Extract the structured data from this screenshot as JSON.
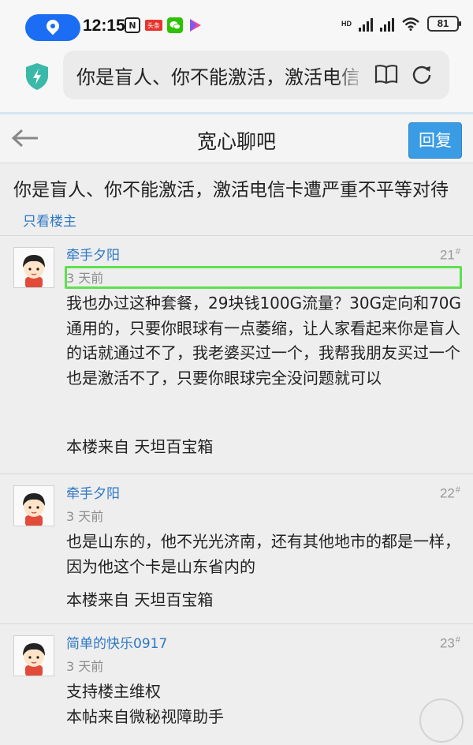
{
  "status_bar": {
    "time": "12:15",
    "battery": "81",
    "network": "HD",
    "app_badge": "头条"
  },
  "browser": {
    "url_text": "你是盲人、你不能激活，激活电信卡遭严重不平等对待"
  },
  "header": {
    "title": "宽心聊吧",
    "reply_label": "回复"
  },
  "thread": {
    "title": "你是盲人、你不能激活，激活电信卡遭严重不平等对待",
    "op_only_label": "只看楼主"
  },
  "posts": [
    {
      "author": "牵手夕阳",
      "floor": "21",
      "floor_mark": "#",
      "ago": "3 天前",
      "body": "我也办过这种套餐，29块钱100G流量？30G定向和70G通用的，只要你眼球有一点萎缩，让人家看起来你是盲人的话就通过不了，我老婆买过一个，我帮我朋友买过一个也是激活不了，只要你眼球完全没问题就可以",
      "source": "本楼来自 天坦百宝箱"
    },
    {
      "author": "牵手夕阳",
      "floor": "22",
      "floor_mark": "#",
      "ago": "3 天前",
      "body": "也是山东的，他不光光济南，还有其他地市的都是一样，因为他这个卡是山东省内的",
      "source": "本楼来自 天坦百宝箱"
    },
    {
      "author": "简单的快乐0917",
      "floor": "23",
      "floor_mark": "#",
      "ago": "3 天前",
      "body": "支持楼主维权",
      "source": "本帖来自微秘视障助手"
    }
  ]
}
